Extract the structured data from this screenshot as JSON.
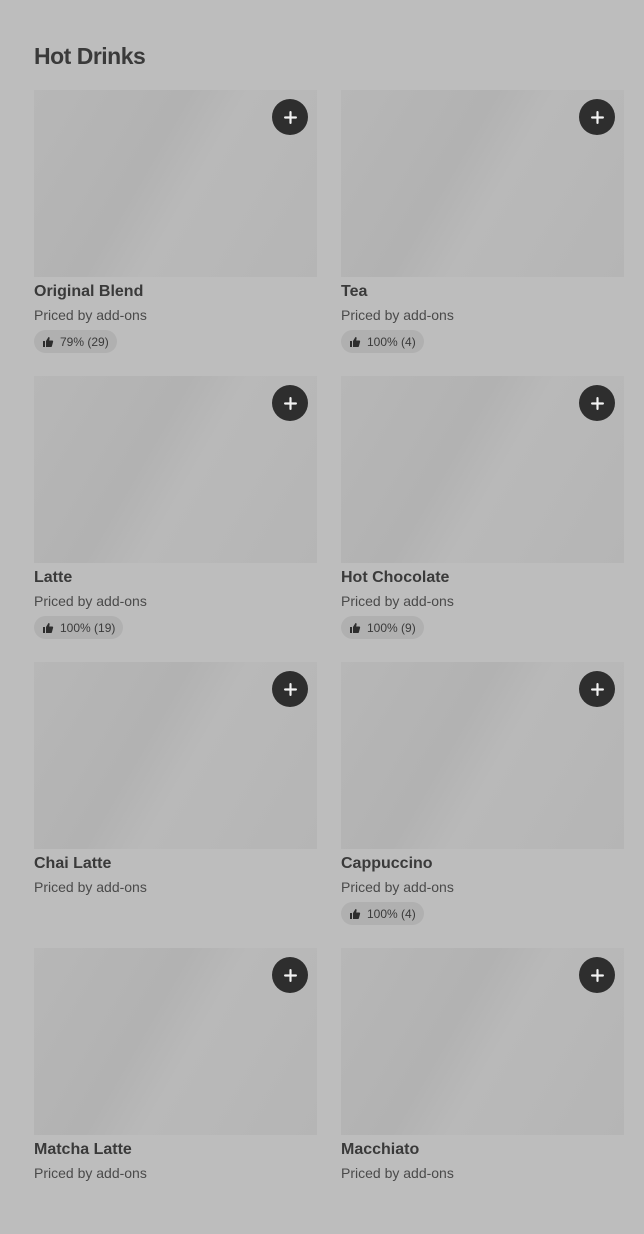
{
  "section": {
    "title": "Hot Drinks"
  },
  "items": [
    {
      "name": "Original Blend",
      "price": "Priced by add-ons",
      "rating": "79% (29)",
      "has_rating": true
    },
    {
      "name": "Tea",
      "price": "Priced by add-ons",
      "rating": "100% (4)",
      "has_rating": true
    },
    {
      "name": "Latte",
      "price": "Priced by add-ons",
      "rating": "100% (19)",
      "has_rating": true
    },
    {
      "name": "Hot Chocolate",
      "price": "Priced by add-ons",
      "rating": "100% (9)",
      "has_rating": true
    },
    {
      "name": "Chai Latte",
      "price": "Priced by add-ons",
      "rating": "",
      "has_rating": false
    },
    {
      "name": "Cappuccino",
      "price": "Priced by add-ons",
      "rating": "100% (4)",
      "has_rating": true
    },
    {
      "name": "Matcha Latte",
      "price": "Priced by add-ons",
      "rating": "",
      "has_rating": false
    },
    {
      "name": "Macchiato",
      "price": "Priced by add-ons",
      "rating": "",
      "has_rating": false
    }
  ],
  "icons": {
    "add": "plus-icon",
    "rating": "thumbs-up-icon"
  },
  "colors": {
    "background": "#bdbdbd",
    "button": "#2e2e2e",
    "image_placeholder": "#b5b5b5"
  }
}
